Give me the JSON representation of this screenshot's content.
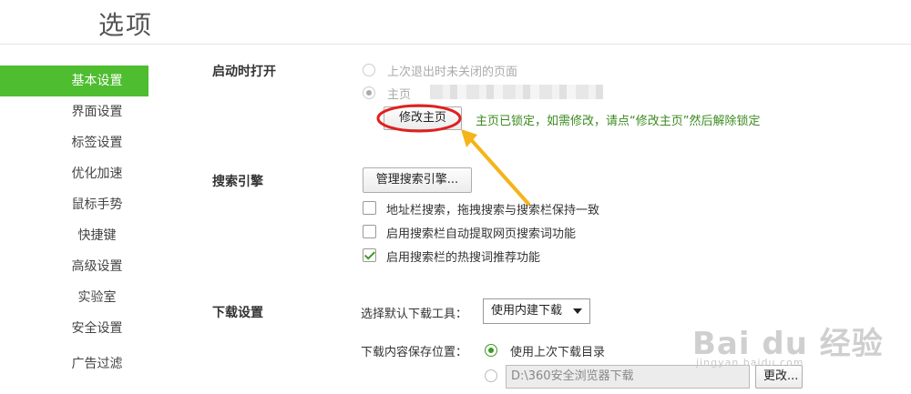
{
  "header": {
    "title": "选项"
  },
  "sidebar": {
    "items": [
      {
        "label": "基本设置",
        "active": true
      },
      {
        "label": "界面设置"
      },
      {
        "label": "标签设置"
      },
      {
        "label": "优化加速"
      },
      {
        "label": "鼠标手势"
      },
      {
        "label": "快捷键"
      },
      {
        "label": "高级设置"
      },
      {
        "label": "实验室"
      },
      {
        "label": "安全设置"
      },
      {
        "label": "广告过滤"
      }
    ]
  },
  "startup": {
    "label": "启动时打开",
    "option_last_session": "上次退出时未关闭的页面",
    "option_homepage": "主页",
    "change_homepage_button": "修改主页",
    "locked_note": "主页已锁定，如需修改，请点“修改主页”然后解除锁定"
  },
  "search": {
    "label": "搜索引擎",
    "manage_button": "管理搜索引擎...",
    "opt_sync": "地址栏搜索，拖拽搜索与搜索栏保持一致",
    "opt_sync_checked": false,
    "opt_extract": "启用搜索栏自动提取网页搜索词功能",
    "opt_extract_checked": false,
    "opt_hot": "启用搜索栏的热搜词推荐功能",
    "opt_hot_checked": true
  },
  "download": {
    "label": "下载设置",
    "tool_label": "选择默认下载工具：",
    "tool_selected": "使用内建下载",
    "location_label": "下载内容保存位置：",
    "use_last_dir": "使用上次下载目录",
    "path_value": "D:\\360安全浏览器下载",
    "change_button": "更改..."
  },
  "watermark": {
    "text": "Bai du 经验",
    "url": "jingyan.baidu.com"
  },
  "colors": {
    "accent_green": "#4ebd2f",
    "note_green": "#3b8a1f",
    "annotation_red": "#e02020",
    "annotation_arrow": "#f4b41a"
  }
}
